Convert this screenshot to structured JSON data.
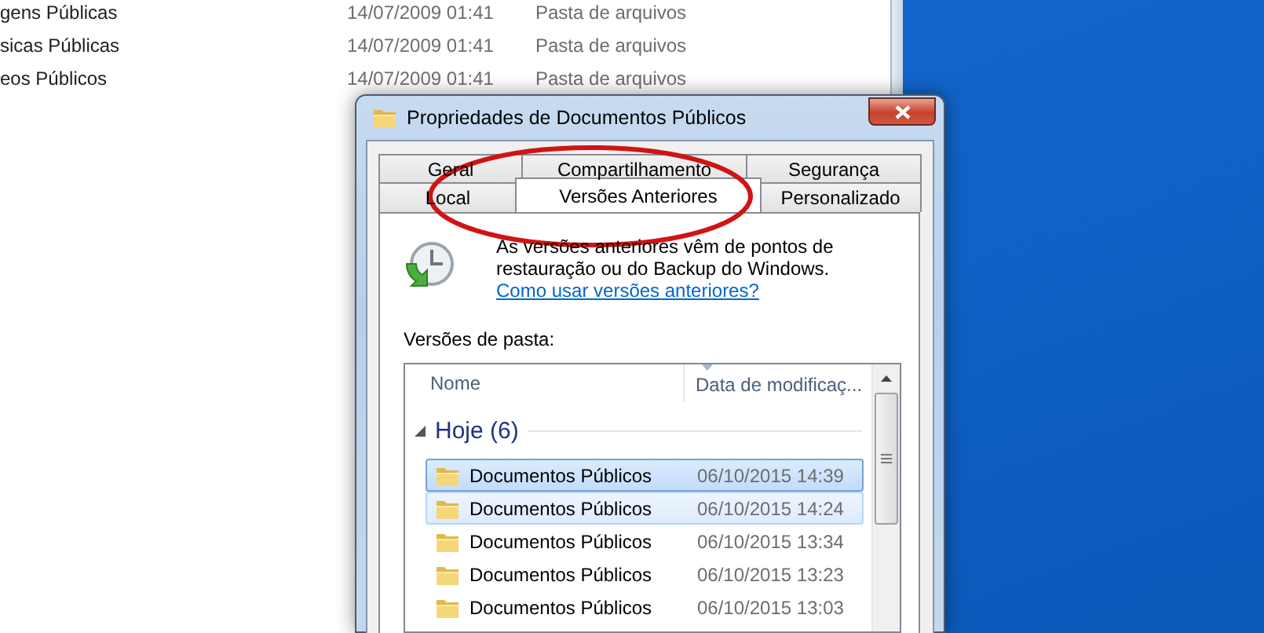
{
  "explorer": {
    "rows": [
      {
        "name": "gens Públicas",
        "date": "14/07/2009 01:41",
        "type": "Pasta de arquivos"
      },
      {
        "name": "sicas Públicas",
        "date": "14/07/2009 01:41",
        "type": "Pasta de arquivos"
      },
      {
        "name": "eos Públicos",
        "date": "14/07/2009 01:41",
        "type": "Pasta de arquivos"
      }
    ]
  },
  "dialog": {
    "title": "Propriedades de Documentos Públicos",
    "tab_rows": [
      [
        {
          "label": "Geral",
          "selected": false
        },
        {
          "label": "Compartilhamento",
          "selected": false
        },
        {
          "label": "Segurança",
          "selected": false
        }
      ],
      [
        {
          "label": "Local",
          "selected": false
        },
        {
          "label": "Versões Anteriores",
          "selected": true
        },
        {
          "label": "Personalizado",
          "selected": false
        }
      ]
    ],
    "description": "As versões anteriores vêm de pontos de restauração ou do Backup do Windows.",
    "help_link": "Como usar versões anteriores?",
    "list_label": "Versões de pasta:",
    "columns": [
      {
        "label": "Nome",
        "sorted": false
      },
      {
        "label": "Data de modificaç...",
        "sorted": true
      }
    ],
    "groups": [
      {
        "label": "Hoje (6)",
        "expanded": true,
        "rows": [
          {
            "name": "Documentos Públicos",
            "date": "06/10/2015 14:39",
            "selected": true,
            "focused": true
          },
          {
            "name": "Documentos Públicos",
            "date": "06/10/2015 14:24",
            "selected": true,
            "focused": false
          },
          {
            "name": "Documentos Públicos",
            "date": "06/10/2015 13:34",
            "selected": false,
            "focused": false
          },
          {
            "name": "Documentos Públicos",
            "date": "06/10/2015 13:23",
            "selected": false,
            "focused": false
          },
          {
            "name": "Documentos Públicos",
            "date": "06/10/2015 13:03",
            "selected": false,
            "focused": false
          }
        ]
      }
    ]
  },
  "annotations": [
    {
      "kind": "ellipse"
    }
  ]
}
